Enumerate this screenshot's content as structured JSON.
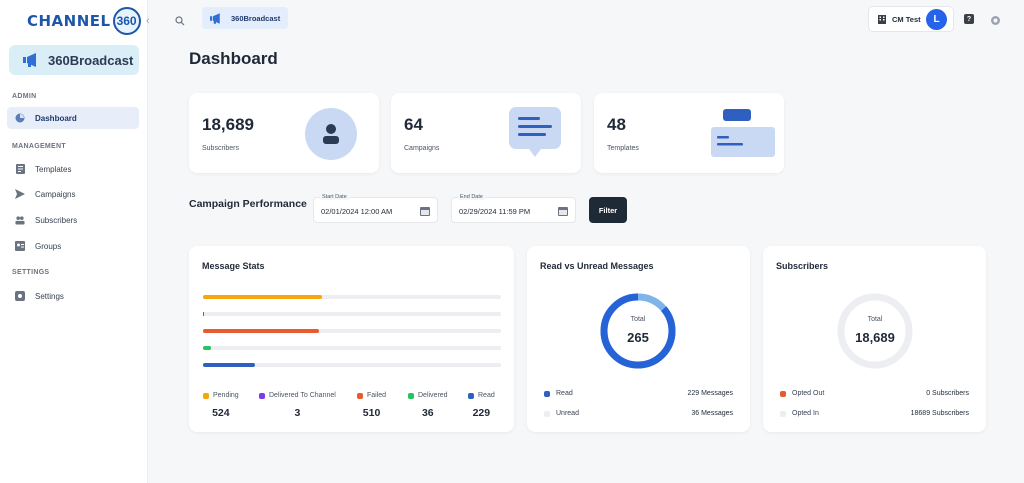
{
  "sidebar": {
    "logo_text": "CHANNEL",
    "logo_number": "360",
    "brand": "360Broadcast",
    "sections": {
      "admin": "ADMIN",
      "management": "MANAGEMENT",
      "settings": "SETTINGS"
    },
    "items": [
      {
        "label": "Dashboard",
        "icon": "dashboard-icon",
        "active": true
      },
      {
        "label": "Templates",
        "icon": "template-icon"
      },
      {
        "label": "Campaigns",
        "icon": "send-icon"
      },
      {
        "label": "Subscribers",
        "icon": "users-icon"
      },
      {
        "label": "Groups",
        "icon": "group-icon"
      },
      {
        "label": "Settings",
        "icon": "gear-icon"
      }
    ]
  },
  "header": {
    "brand": "360Broadcast",
    "user_name": "CM Test",
    "avatar_letter": "L"
  },
  "page": {
    "title": "Dashboard"
  },
  "summary": [
    {
      "value": "18,689",
      "label": "Subscribers"
    },
    {
      "value": "64",
      "label": "Campaigns"
    },
    {
      "value": "48",
      "label": "Templates"
    }
  ],
  "performance": {
    "title": "Campaign Performance",
    "start_label": "Start Date",
    "start_value": "02/01/2024 12:00 AM",
    "end_label": "End Date",
    "end_value": "02/29/2024 11:59 PM",
    "filter_label": "Filter"
  },
  "message_stats": {
    "title": "Message Stats",
    "items": [
      {
        "label": "Pending",
        "value": "524",
        "color": "#f5a70b",
        "fraction": 0.4
      },
      {
        "label": "Delivered To Channel",
        "value": "3",
        "color": "#7c3aed",
        "fraction": 0.003
      },
      {
        "label": "Failed",
        "value": "510",
        "color": "#ea5a2f",
        "fraction": 0.39
      },
      {
        "label": "Delivered",
        "value": "36",
        "color": "#22c55e",
        "fraction": 0.027
      },
      {
        "label": "Read",
        "value": "229",
        "color": "#2f5fbf",
        "fraction": 0.175
      }
    ]
  },
  "read_unread": {
    "title": "Read vs Unread Messages",
    "total_label": "Total",
    "total_value": "265",
    "rows": [
      {
        "label": "Read",
        "value": "229 Messages",
        "color": "#2f5fbf"
      },
      {
        "label": "Unread",
        "value": "36 Messages",
        "color": "#eceef1"
      }
    ],
    "read_fraction": 0.864
  },
  "subscribers_panel": {
    "title": "Subscribers",
    "total_label": "Total",
    "total_value": "18,689",
    "rows": [
      {
        "label": "Opted Out",
        "value": "0 Subscribers",
        "color": "#ea5a2f"
      },
      {
        "label": "Opted In",
        "value": "18689 Subscribers",
        "color": "#eceef1"
      }
    ]
  }
}
